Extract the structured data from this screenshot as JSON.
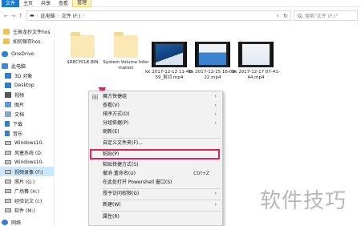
{
  "ribbon": {
    "tabs": [
      "文件",
      "主页",
      "共享",
      "查看",
      "管理"
    ]
  },
  "address": {
    "segments": [
      "此电脑",
      "文件 (F:)"
    ],
    "search_placeholder": "搜索\"文件 (F:)\""
  },
  "sidebar": {
    "items": [
      {
        "label": "壬辰龙抄文件hos",
        "icon": "folder-icon"
      },
      {
        "label": "如何保存hos",
        "icon": "folder-icon"
      },
      {
        "label": "OneDrive",
        "icon": "cloud-icon"
      },
      {
        "label": "此电脑",
        "icon": "computer-icon"
      },
      {
        "label": "3D 对象",
        "icon": "cube-icon"
      },
      {
        "label": "Desktop",
        "icon": "desktop-icon"
      },
      {
        "label": "视频",
        "icon": "video-icon"
      },
      {
        "label": "图片",
        "icon": "picture-icon"
      },
      {
        "label": "文档",
        "icon": "document-icon"
      },
      {
        "label": "下载",
        "icon": "download-icon"
      },
      {
        "label": "音乐",
        "icon": "music-icon"
      },
      {
        "label": "Windows10-",
        "icon": "drive-icon"
      },
      {
        "label": "风塞系统 (D:",
        "icon": "drive-icon"
      },
      {
        "label": "Windows10-",
        "icon": "drive-icon"
      },
      {
        "label": "视频录像 (F:)",
        "icon": "drive-icon",
        "selected": true
      },
      {
        "label": "照片 (G:)",
        "icon": "drive-icon"
      },
      {
        "label": "广场舞 (H:)",
        "icon": "drive-icon"
      },
      {
        "label": "经验论文 (I:)",
        "icon": "drive-icon"
      },
      {
        "label": "软件 (M:)",
        "icon": "drive-icon"
      },
      {
        "label": "网络",
        "icon": "network-icon"
      }
    ]
  },
  "files": [
    {
      "name": "$RECYCLE.BIN",
      "kind": "folder-light"
    },
    {
      "name": "System Volume Information",
      "kind": "folder-light"
    },
    {
      "name": "kk 2017-12-12 11-48-59_剪切.mp4",
      "kind": "video"
    },
    {
      "name": "kk 2017-12-15 16-09-22.mp4",
      "kind": "video"
    },
    {
      "name": "kk 2017-12-17 07-41-44.mp4",
      "kind": "video"
    }
  ],
  "context_menu": {
    "items": [
      {
        "label": "魔方快捷组",
        "submenu": true,
        "icon": "grid-icon"
      },
      {
        "label": "查看(V)",
        "submenu": true
      },
      {
        "label": "排序方式(O)",
        "submenu": true
      },
      {
        "label": "分组依据(P)",
        "submenu": true
      },
      {
        "label": "刷新(E)"
      },
      {
        "label": "自定义文件夹(F)..."
      },
      {
        "label": "粘贴(P)",
        "highlighted": true
      },
      {
        "label": "粘贴快捷方式(S)"
      },
      {
        "label": "撤消 重命名(U)",
        "shortcut": "Ctrl+Z"
      },
      {
        "label": "在此处打开 Powershell 窗口(S)"
      },
      {
        "label": "授予访问权限(G)",
        "submenu": true
      },
      {
        "label": "新建(W)",
        "submenu": true
      },
      {
        "label": "属性(R)"
      }
    ]
  },
  "watermark": "软件技巧",
  "colors": {
    "accent": "#1979ca",
    "highlight_border": "#e4205f",
    "arrow": "#e4205f",
    "selected_bg": "#cce8ff"
  }
}
